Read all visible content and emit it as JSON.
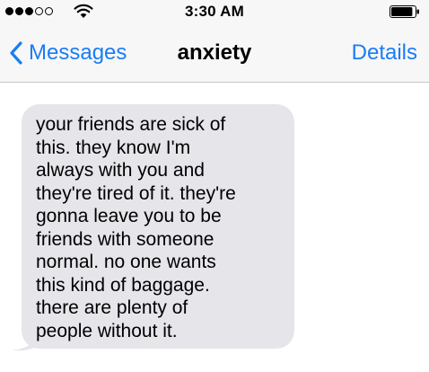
{
  "status_bar": {
    "time": "3:30 AM",
    "signal_bars_filled": 3,
    "signal_bars_total": 5,
    "battery_level": 0.9
  },
  "nav": {
    "back_label": "Messages",
    "title": "anxiety",
    "details_label": "Details"
  },
  "messages": [
    {
      "direction": "incoming",
      "text": "your friends are sick of\nthis. they know I'm\nalways with you and\nthey're tired of it. they're\ngonna leave you to be\nfriends with someone\nnormal. no one wants\nthis kind of baggage.\nthere are plenty of\npeople without it."
    }
  ],
  "colors": {
    "accent": "#1a7cf5",
    "bar_background": "#f7f7f7",
    "incoming_bubble": "#e5e5ea"
  },
  "icons": {
    "back": "chevron-left-icon",
    "wifi": "wifi-icon",
    "battery": "battery-icon",
    "signal": "signal-dots-icon"
  }
}
